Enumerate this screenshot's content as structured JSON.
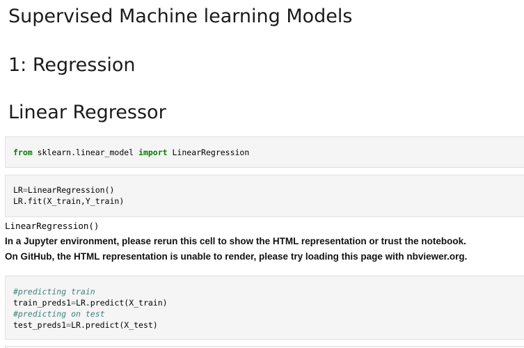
{
  "headings": {
    "main": "Supervised Machine learning Models",
    "section": "1: Regression",
    "subsection": "Linear Regressor"
  },
  "cell1": {
    "kw_from": "from",
    "module": " sklearn.linear_model ",
    "kw_import": "import",
    "name": " LinearRegression"
  },
  "cell2": {
    "line1_a": "LR",
    "line1_eq": "=",
    "line1_b": "LinearRegression()",
    "line2": "LR.fit(X_train,Y_train)"
  },
  "output": {
    "repr": "LinearRegression()",
    "note1": "In a Jupyter environment, please rerun this cell to show the HTML representation or trust the notebook.",
    "note2": "On GitHub, the HTML representation is unable to render, please try loading this page with nbviewer.org."
  },
  "cell3": {
    "comment1": "#predicting train",
    "line2_a": "train_preds1",
    "line2_eq": "=",
    "line2_b": "LR.predict(X_train)",
    "comment2": "#predicting on test",
    "line4_a": "test_preds1",
    "line4_eq": "=",
    "line4_b": "LR.predict(X_test)"
  }
}
